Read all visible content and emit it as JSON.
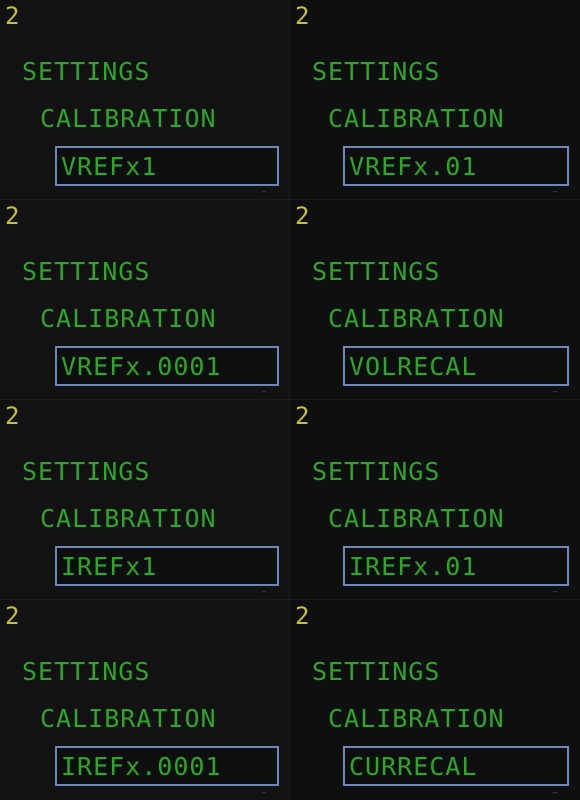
{
  "colors": {
    "number": "#c7c23a",
    "text": "#2fa52a",
    "selection_border": "#6f86b8",
    "background": "#111211"
  },
  "panels": [
    {
      "number": "2",
      "title": "SETTINGS",
      "subtitle": "CALIBRATION",
      "selected_item": "VREFx1"
    },
    {
      "number": "2",
      "title": "SETTINGS",
      "subtitle": "CALIBRATION",
      "selected_item": "VREFx.01"
    },
    {
      "number": "2",
      "title": "SETTINGS",
      "subtitle": "CALIBRATION",
      "selected_item": "VREFx.0001"
    },
    {
      "number": "2",
      "title": "SETTINGS",
      "subtitle": "CALIBRATION",
      "selected_item": "VOLRECAL"
    },
    {
      "number": "2",
      "title": "SETTINGS",
      "subtitle": "CALIBRATION",
      "selected_item": "IREFx1"
    },
    {
      "number": "2",
      "title": "SETTINGS",
      "subtitle": "CALIBRATION",
      "selected_item": "IREFx.01"
    },
    {
      "number": "2",
      "title": "SETTINGS",
      "subtitle": "CALIBRATION",
      "selected_item": "IREFx.0001"
    },
    {
      "number": "2",
      "title": "SETTINGS",
      "subtitle": "CALIBRATION",
      "selected_item": "CURRECAL"
    }
  ]
}
